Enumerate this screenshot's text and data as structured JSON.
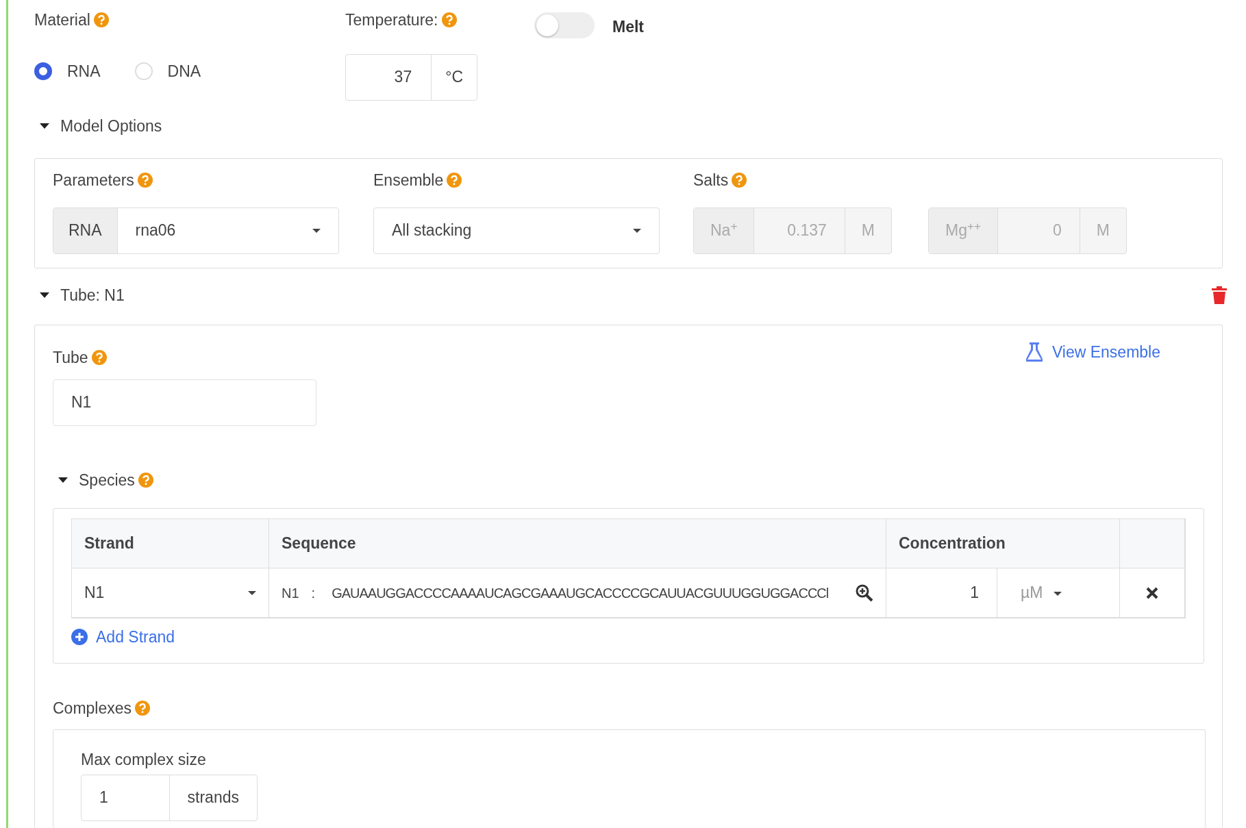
{
  "material": {
    "label": "Material",
    "options": [
      {
        "label": "RNA",
        "selected": true
      },
      {
        "label": "DNA",
        "selected": false
      }
    ]
  },
  "temperature": {
    "label": "Temperature:",
    "value": "37",
    "unit": "°C"
  },
  "melt": {
    "label": "Melt",
    "on": false
  },
  "model_options": {
    "title": "Model Options",
    "expanded": true,
    "parameters": {
      "label": "Parameters",
      "prefix": "RNA",
      "value": "rna06"
    },
    "ensemble": {
      "label": "Ensemble",
      "value": "All stacking"
    },
    "salts": {
      "label": "Salts",
      "items": [
        {
          "ion": "Na$^{+}$",
          "value": "0.137",
          "unit": "M",
          "disabled": true
        },
        {
          "ion": "Mg$^{++}$",
          "value": "0",
          "unit": "M",
          "disabled": true
        }
      ]
    }
  },
  "tube": {
    "title": "Tube: N1",
    "expanded": true,
    "label": "Tube",
    "value": "N1",
    "view_link": "View Ensemble",
    "species": {
      "title": "Species",
      "expanded": true,
      "columns": [
        "Strand",
        "Sequence",
        "Concentration"
      ],
      "rows": [
        {
          "strand": "N1",
          "seq_name": "N1",
          "separator": ":",
          "sequence": "GAUAAUGGACCCCAAAAUCAGCGAAAUGCACCCCGCAUUACGUUUGGUGGACCCl",
          "concentration": "1",
          "unit": "µM"
        }
      ],
      "add_button": "Add Strand"
    },
    "complexes": {
      "label": "Complexes",
      "max_label": "Max complex size",
      "max_value": "1",
      "max_unit": "strands"
    }
  }
}
